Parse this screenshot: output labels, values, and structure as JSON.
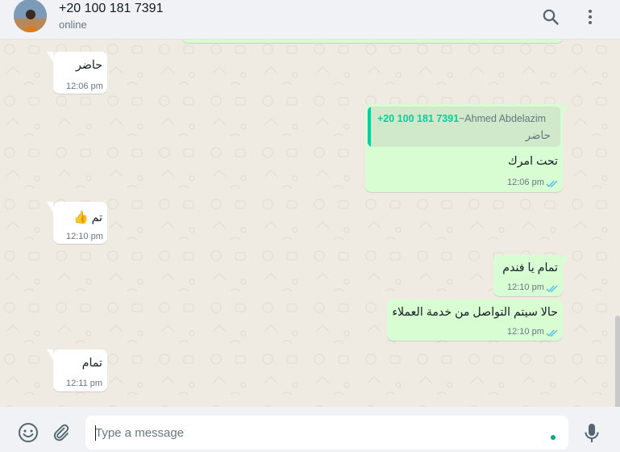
{
  "header": {
    "contact_name": "+20 100 181 7391",
    "status": "online"
  },
  "messages": [
    {
      "direction": "in",
      "text": "حاضر",
      "time": "12:06 pm"
    },
    {
      "direction": "out",
      "quote_number": "+20 100 181 7391",
      "quote_author": "~Ahmed Abdelazim",
      "quote_text": "حاضر",
      "text": "تحت امرك",
      "time": "12:06 pm"
    },
    {
      "direction": "in",
      "text": "تم",
      "emoji": "👍",
      "time": "12:10 pm"
    },
    {
      "direction": "out",
      "text": "تمام يا فندم",
      "time": "12:10 pm"
    },
    {
      "direction": "out",
      "text": "حالا سيتم التواصل من خدمة العملاء",
      "time": "12:10 pm"
    },
    {
      "direction": "in",
      "text": "تمام",
      "time": "12:11 pm"
    }
  ],
  "composer": {
    "placeholder": "Type a message"
  },
  "colors": {
    "incoming_bubble": "#ffffff",
    "outgoing_bubble": "#d9fdd3",
    "read_ticks": "#53bdeb",
    "accent": "#00a884",
    "chat_background": "#efeae2"
  },
  "icons": {
    "search": "search-icon",
    "menu": "menu-icon",
    "emoji": "emoji-icon",
    "attach": "attach-icon",
    "mic": "mic-icon"
  }
}
